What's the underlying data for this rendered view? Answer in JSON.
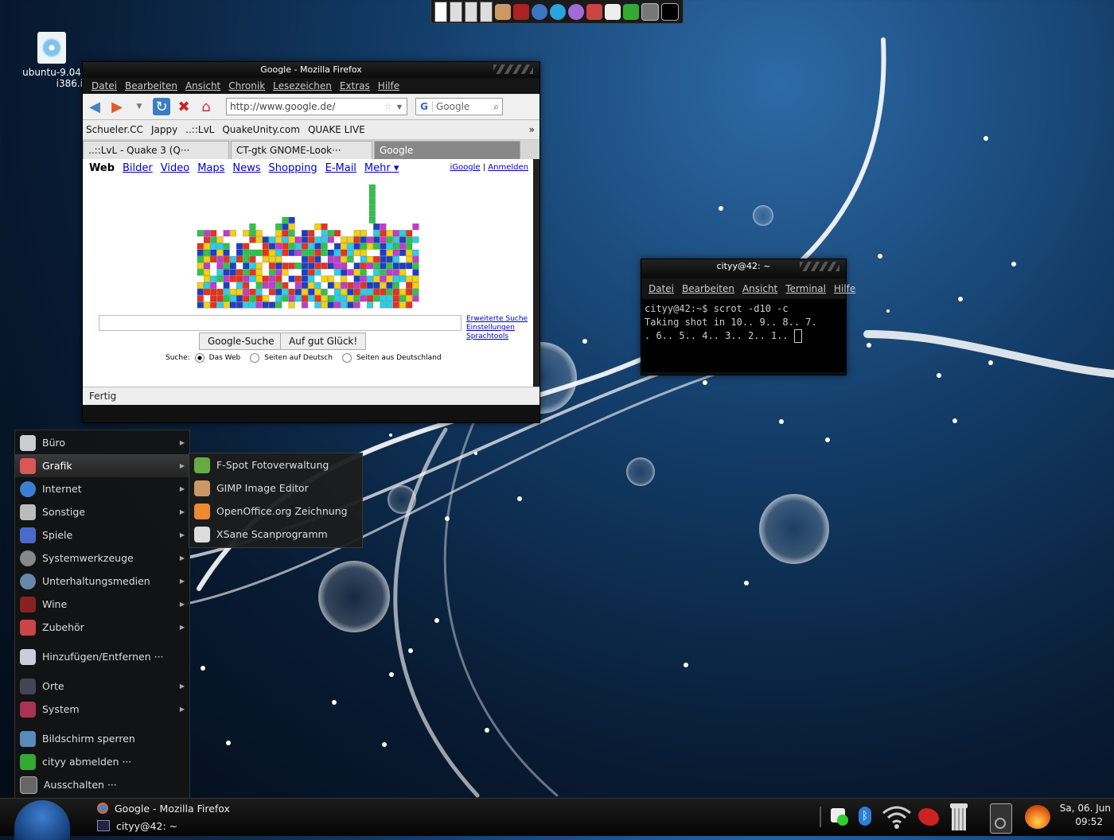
{
  "desktop": {
    "icon_label_line1": "ubuntu-9.04",
    "icon_label_line2": "i386.i"
  },
  "firefox": {
    "title": "Google - Mozilla Firefox",
    "menu": [
      "Datei",
      "Bearbeiten",
      "Ansicht",
      "Chronik",
      "Lesezeichen",
      "Extras",
      "Hilfe"
    ],
    "url": "http://www.google.de/",
    "search_placeholder": "Google",
    "bookmarks": [
      "Schueler.CC",
      "Jappy",
      "..::LvL",
      "QuakeUnity.com",
      "QUAKE LIVE"
    ],
    "bookmarks_more": "»",
    "tabs": [
      "..::LvL - Quake 3 (Q···",
      "CT-gtk GNOME-Look···",
      "Google"
    ],
    "google": {
      "nav_active": "Web",
      "nav_links": [
        "Bilder",
        "Video",
        "Maps",
        "News",
        "Shopping",
        "E-Mail",
        "Mehr ▾"
      ],
      "right_links": [
        "iGoogle",
        "Anmelden"
      ],
      "right_sep": "|",
      "side_links": [
        "Erweiterte Suche",
        "Einstellungen",
        "Sprachtools"
      ],
      "button_search": "Google-Suche",
      "button_lucky": "Auf gut Glück!",
      "radio_label": "Suche:",
      "radio_options": [
        "Das Web",
        "Seiten auf Deutsch",
        "Seiten aus Deutschland"
      ]
    },
    "status": "Fertig"
  },
  "terminal": {
    "title": "cityy@42: ~",
    "menu": [
      "Datei",
      "Bearbeiten",
      "Ansicht",
      "Terminal",
      "Hilfe"
    ],
    "lines": [
      "cityy@42:~$ scrot -d10 -c",
      "Taking shot in 10.. 9.. 8.. 7.",
      ". 6.. 5.. 4.. 3.. 2.. 1.."
    ]
  },
  "start_menu": {
    "items": [
      "Büro",
      "Grafik",
      "Internet",
      "Sonstige",
      "Spiele",
      "Systemwerkzeuge",
      "Unterhaltungsmedien",
      "Wine",
      "Zubehör"
    ],
    "add_remove": "Hinzufügen/Entfernen ···",
    "places": [
      "Orte",
      "System"
    ],
    "session": [
      "Bildschirm sperren",
      "cityy abmelden ···",
      "Ausschalten ···"
    ],
    "highlighted": "Grafik"
  },
  "graphics_submenu": [
    "F-Spot Fotoverwaltung",
    "GIMP Image Editor",
    "OpenOffice.org Zeichnung",
    "XSane Scanprogramm"
  ],
  "taskbar": {
    "tasks": [
      "Google - Mozilla Firefox",
      "cityy@42: ~"
    ],
    "date": "Sa, 06. Jun",
    "time": "09:52"
  },
  "colors": {
    "accent_blue": "#1f5f9e",
    "link_blue": "#0000cc",
    "panel_dark": "#111111"
  }
}
